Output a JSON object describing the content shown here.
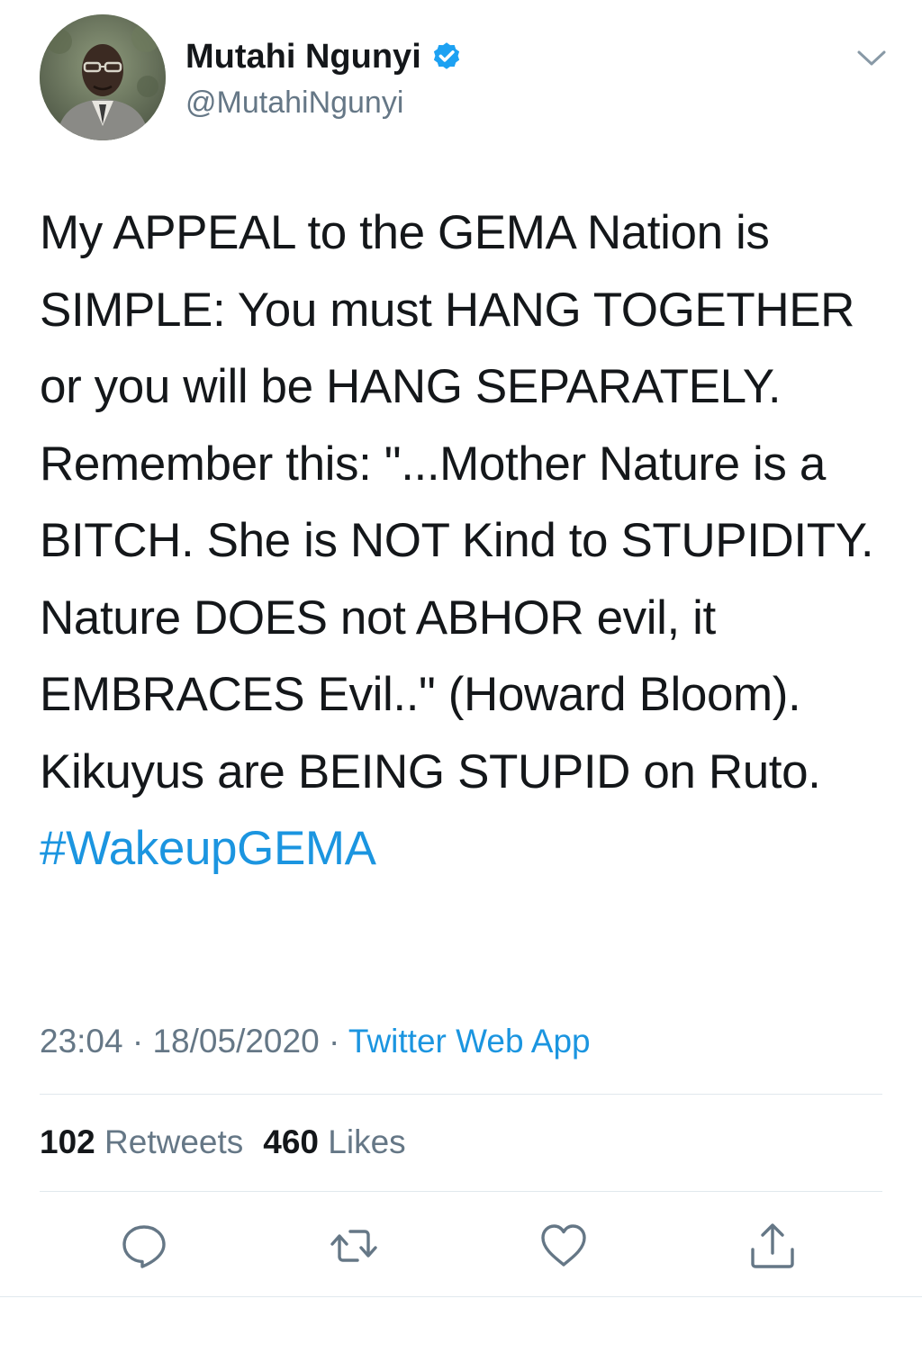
{
  "author": {
    "display_name": "Mutahi Ngunyi",
    "handle": "@MutahiNgunyi",
    "verified": true,
    "avatar_icon": "profile-photo"
  },
  "tweet": {
    "text": "My APPEAL to the GEMA Nation is SIMPLE: You must HANG TOGETHER or you will be HANG SEPARATELY. Remember this: \"...Mother Nature is a BITCH. She is NOT Kind to STUPIDITY. Nature DOES not ABHOR evil, it EMBRACES Evil..\" (Howard Bloom). Kikuyus are BEING STUPID on Ruto.",
    "hashtag": "#WakeupGEMA",
    "time": "23:04",
    "separator": " · ",
    "date": "18/05/2020",
    "source": "Twitter Web App"
  },
  "stats": {
    "retweets_count": "102",
    "retweets_label": "Retweets",
    "likes_count": "460",
    "likes_label": "Likes"
  },
  "actions": {
    "reply_icon": "speech-bubble-icon",
    "retweet_icon": "retweet-arrows-icon",
    "like_icon": "heart-icon",
    "share_icon": "share-upload-icon"
  },
  "colors": {
    "text": "#14171a",
    "secondary": "#657786",
    "link": "#1b95e0",
    "divider": "#e1e8ed"
  }
}
